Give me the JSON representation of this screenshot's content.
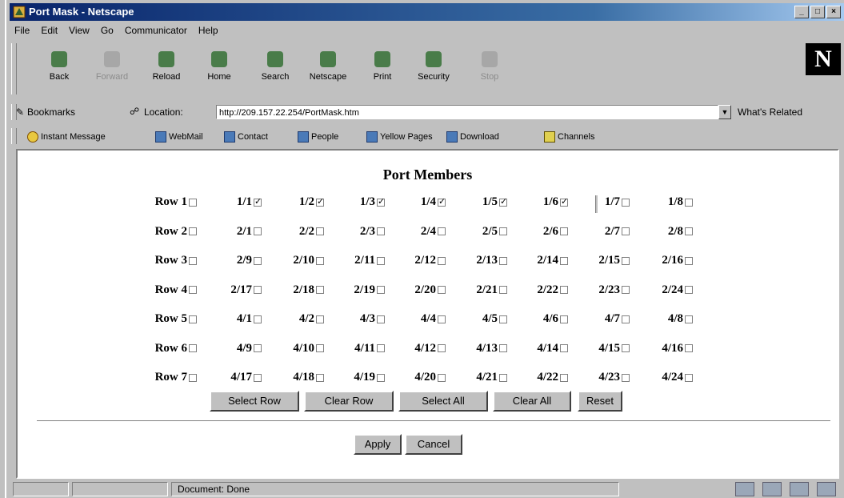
{
  "window": {
    "title": "Port Mask - Netscape"
  },
  "menu": [
    "File",
    "Edit",
    "View",
    "Go",
    "Communicator",
    "Help"
  ],
  "toolbar": [
    {
      "label": "Back",
      "icon": "back-icon",
      "enabled": true
    },
    {
      "label": "Forward",
      "icon": "forward-icon",
      "enabled": false
    },
    {
      "label": "Reload",
      "icon": "reload-icon",
      "enabled": true
    },
    {
      "label": "Home",
      "icon": "home-icon",
      "enabled": true
    },
    {
      "label": "Search",
      "icon": "search-icon",
      "enabled": true
    },
    {
      "label": "Netscape",
      "icon": "netscape-icon",
      "enabled": true
    },
    {
      "label": "Print",
      "icon": "print-icon",
      "enabled": true
    },
    {
      "label": "Security",
      "icon": "security-icon",
      "enabled": true
    },
    {
      "label": "Stop",
      "icon": "stop-icon",
      "enabled": false
    }
  ],
  "logo": "N",
  "location": {
    "bookmarks_label": "Bookmarks",
    "location_label": "Location:",
    "url": "http://209.157.22.254/PortMask.htm",
    "whats_related": "What's Related"
  },
  "links": [
    "Instant Message",
    "WebMail",
    "Contact",
    "People",
    "Yellow Pages",
    "Download",
    "Channels"
  ],
  "page": {
    "title": "Port Members",
    "rows": [
      {
        "label": "Row 1",
        "checked": false,
        "ports": [
          {
            "label": "1/1",
            "checked": true
          },
          {
            "label": "1/2",
            "checked": true
          },
          {
            "label": "1/3",
            "checked": true
          },
          {
            "label": "1/4",
            "checked": true
          },
          {
            "label": "1/5",
            "checked": true
          },
          {
            "label": "1/6",
            "checked": true
          },
          {
            "label": "1/7",
            "checked": false
          },
          {
            "label": "1/8",
            "checked": false
          }
        ]
      },
      {
        "label": "Row 2",
        "checked": false,
        "ports": [
          {
            "label": "2/1",
            "checked": false
          },
          {
            "label": "2/2",
            "checked": false
          },
          {
            "label": "2/3",
            "checked": false
          },
          {
            "label": "2/4",
            "checked": false
          },
          {
            "label": "2/5",
            "checked": false
          },
          {
            "label": "2/6",
            "checked": false
          },
          {
            "label": "2/7",
            "checked": false
          },
          {
            "label": "2/8",
            "checked": false
          }
        ]
      },
      {
        "label": "Row 3",
        "checked": false,
        "ports": [
          {
            "label": "2/9",
            "checked": false
          },
          {
            "label": "2/10",
            "checked": false
          },
          {
            "label": "2/11",
            "checked": false
          },
          {
            "label": "2/12",
            "checked": false
          },
          {
            "label": "2/13",
            "checked": false
          },
          {
            "label": "2/14",
            "checked": false
          },
          {
            "label": "2/15",
            "checked": false
          },
          {
            "label": "2/16",
            "checked": false
          }
        ]
      },
      {
        "label": "Row 4",
        "checked": false,
        "ports": [
          {
            "label": "2/17",
            "checked": false
          },
          {
            "label": "2/18",
            "checked": false
          },
          {
            "label": "2/19",
            "checked": false
          },
          {
            "label": "2/20",
            "checked": false
          },
          {
            "label": "2/21",
            "checked": false
          },
          {
            "label": "2/22",
            "checked": false
          },
          {
            "label": "2/23",
            "checked": false
          },
          {
            "label": "2/24",
            "checked": false
          }
        ]
      },
      {
        "label": "Row 5",
        "checked": false,
        "ports": [
          {
            "label": "4/1",
            "checked": false
          },
          {
            "label": "4/2",
            "checked": false
          },
          {
            "label": "4/3",
            "checked": false
          },
          {
            "label": "4/4",
            "checked": false
          },
          {
            "label": "4/5",
            "checked": false
          },
          {
            "label": "4/6",
            "checked": false
          },
          {
            "label": "4/7",
            "checked": false
          },
          {
            "label": "4/8",
            "checked": false
          }
        ]
      },
      {
        "label": "Row 6",
        "checked": false,
        "ports": [
          {
            "label": "4/9",
            "checked": false
          },
          {
            "label": "4/10",
            "checked": false
          },
          {
            "label": "4/11",
            "checked": false
          },
          {
            "label": "4/12",
            "checked": false
          },
          {
            "label": "4/13",
            "checked": false
          },
          {
            "label": "4/14",
            "checked": false
          },
          {
            "label": "4/15",
            "checked": false
          },
          {
            "label": "4/16",
            "checked": false
          }
        ]
      },
      {
        "label": "Row 7",
        "checked": false,
        "ports": [
          {
            "label": "4/17",
            "checked": false
          },
          {
            "label": "4/18",
            "checked": false
          },
          {
            "label": "4/19",
            "checked": false
          },
          {
            "label": "4/20",
            "checked": false
          },
          {
            "label": "4/21",
            "checked": false
          },
          {
            "label": "4/22",
            "checked": false
          },
          {
            "label": "4/23",
            "checked": false
          },
          {
            "label": "4/24",
            "checked": false
          }
        ]
      }
    ],
    "buttons": [
      "Select Row",
      "Clear Row",
      "Select All",
      "Clear All",
      "Reset"
    ],
    "form_buttons": [
      "Apply",
      "Cancel"
    ]
  },
  "status": {
    "text": "Document: Done"
  }
}
